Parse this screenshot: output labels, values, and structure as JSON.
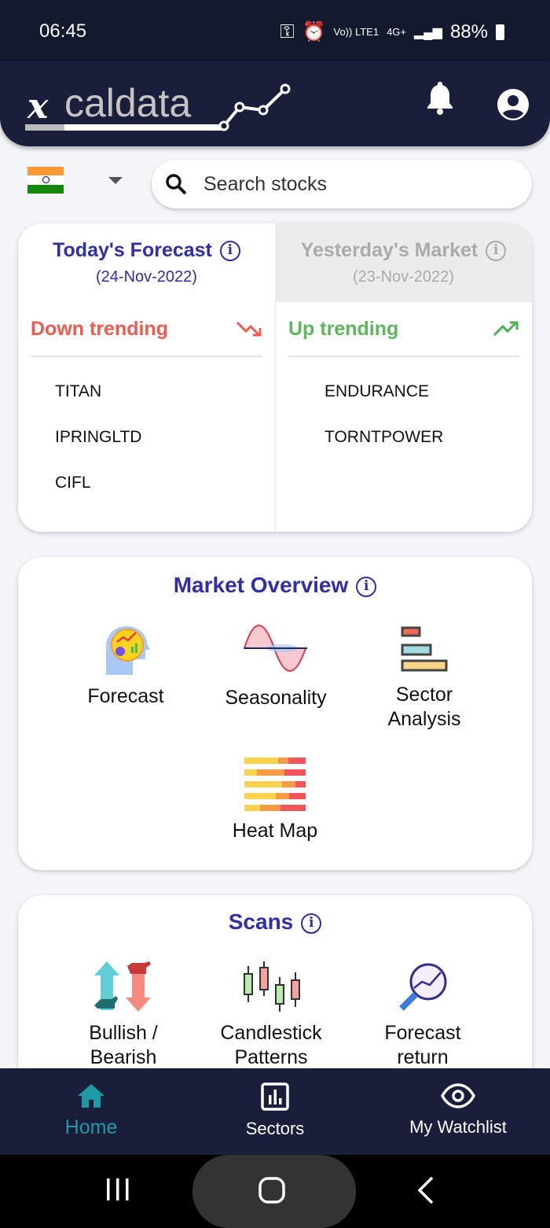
{
  "status_bar": {
    "time": "06:45",
    "network": "Vo)) LTE1",
    "data": "4G+",
    "battery": "88%"
  },
  "header": {
    "logo": "xcaldata",
    "icons": [
      "bell-icon",
      "account-icon"
    ]
  },
  "country": {
    "flag": "india",
    "colors": [
      "#ff9933",
      "#ffffff",
      "#138808"
    ]
  },
  "search": {
    "placeholder": "Search stocks"
  },
  "forecast": {
    "today": {
      "title": "Today's Forecast",
      "date": "(24-Nov-2022)",
      "trend": "Down trending",
      "trend_color": "#f05a4f",
      "stocks": [
        "TITAN",
        "IPRINGLTD",
        "CIFL"
      ]
    },
    "yesterday": {
      "title": "Yesterday's Market",
      "date": "(23-Nov-2022)",
      "trend": "Up trending",
      "trend_color": "#4caf50",
      "stocks": [
        "ENDURANCE",
        "TORNTPOWER"
      ]
    }
  },
  "market_overview": {
    "title": "Market Overview",
    "items": [
      "Forecast",
      "Seasonality",
      "Sector Analysis",
      "Heat Map"
    ]
  },
  "scans": {
    "title": "Scans",
    "items": [
      "Bullish / Bearish",
      "Candlestick Patterns",
      "Forecast return"
    ]
  },
  "bottom_nav": {
    "items": [
      "Home",
      "Sectors",
      "My Watchlist"
    ],
    "active": "Home",
    "active_color": "#1e9aa5"
  }
}
